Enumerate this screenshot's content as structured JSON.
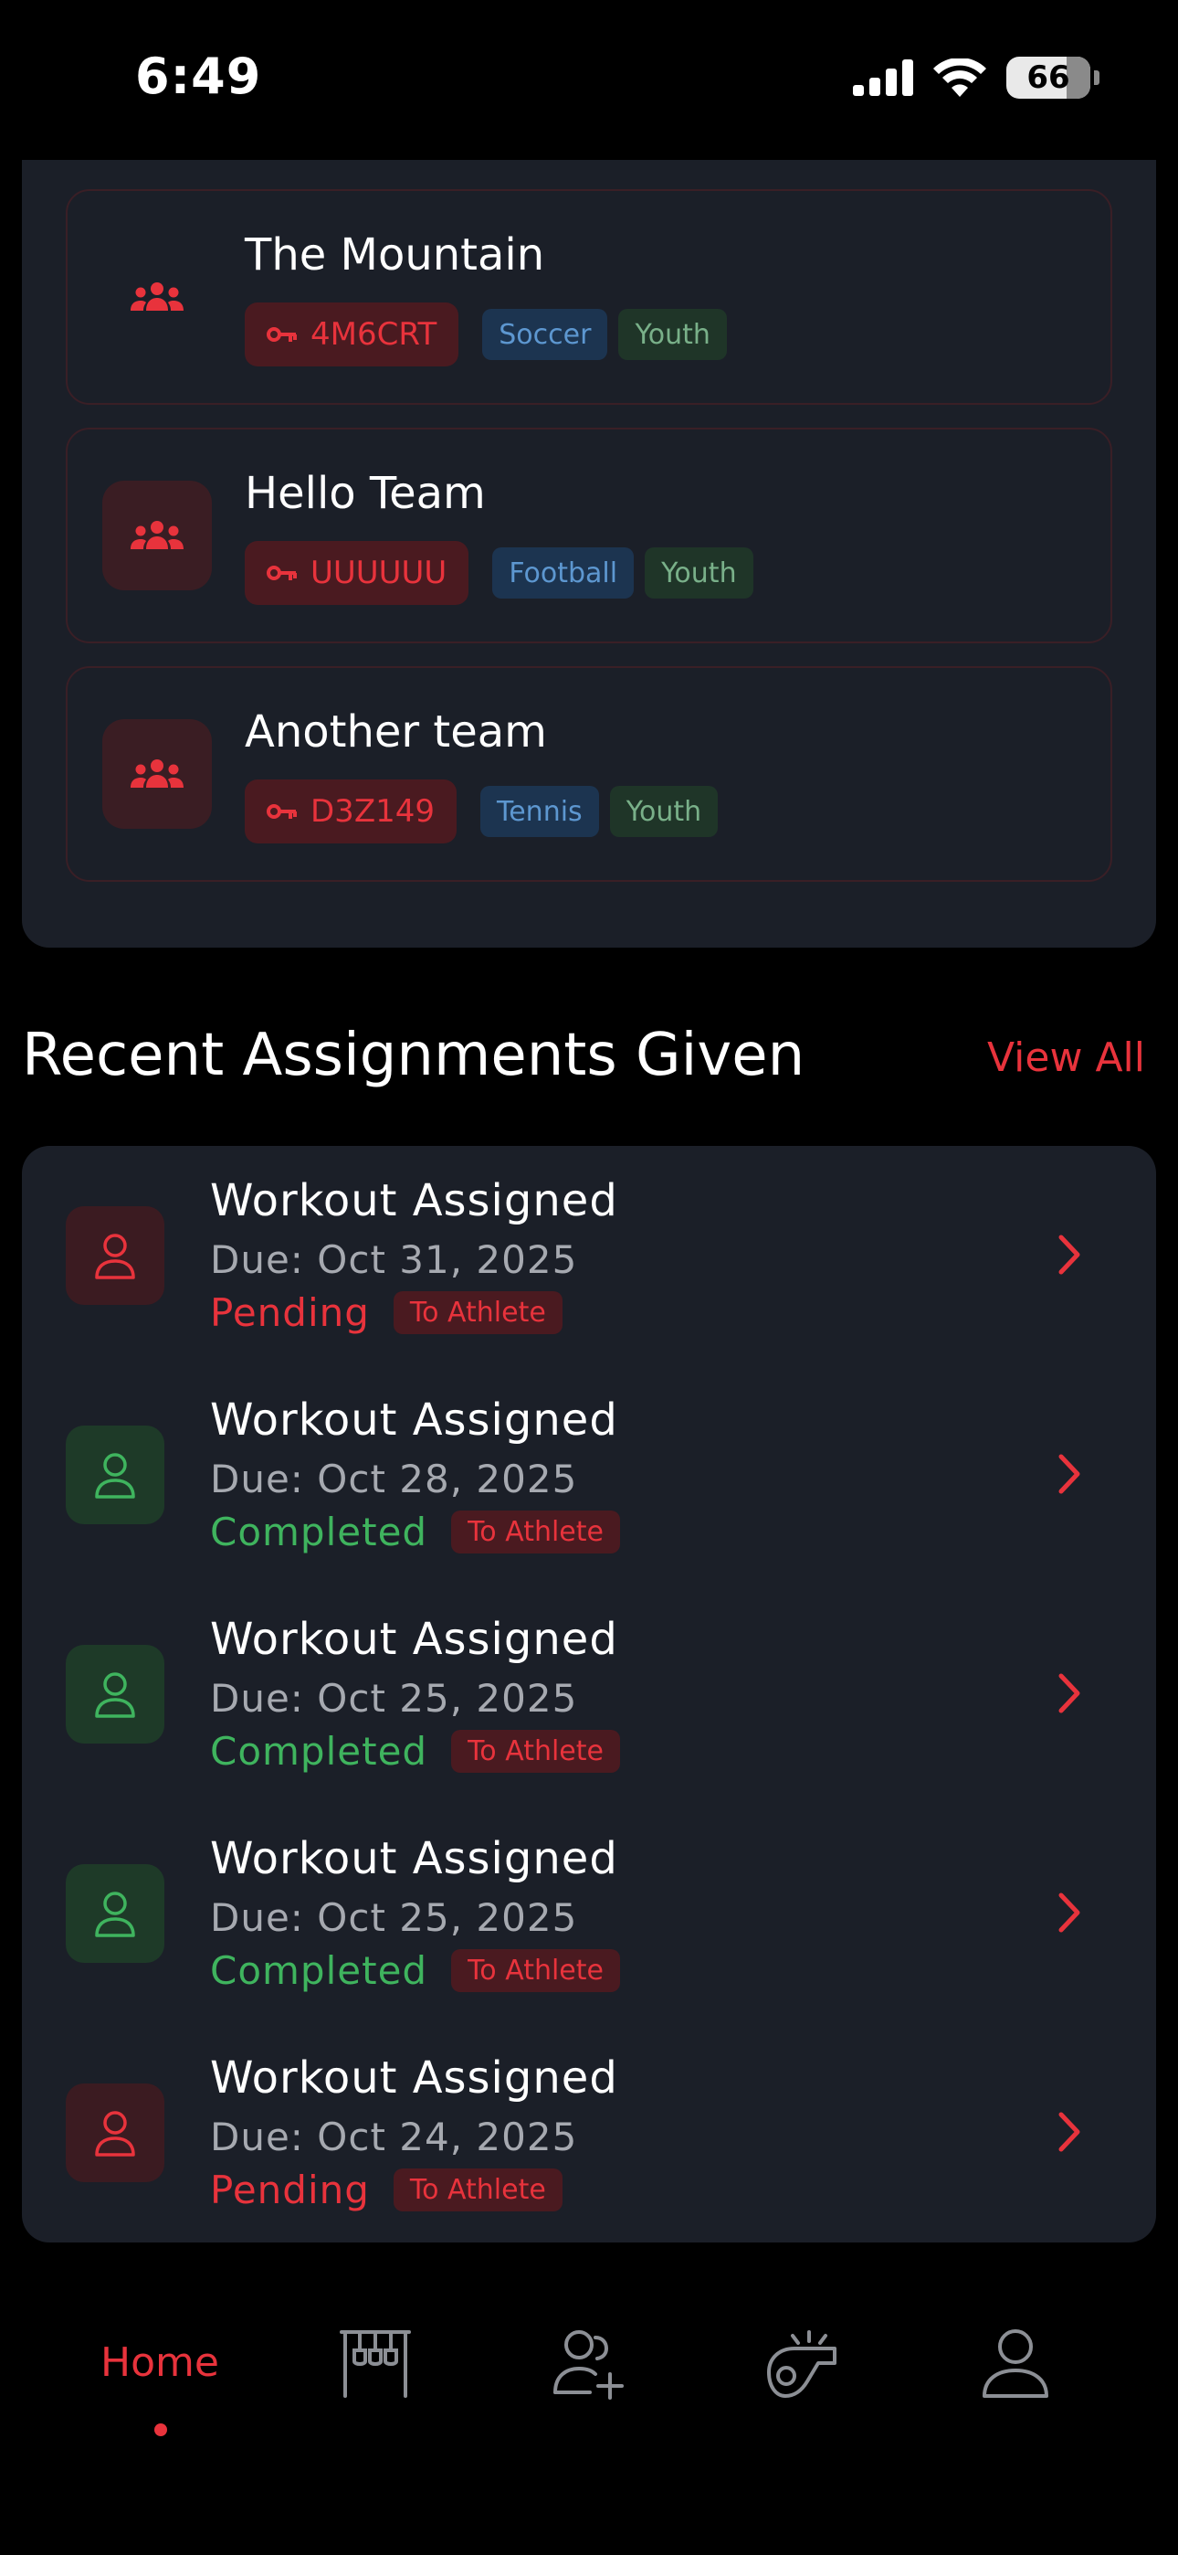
{
  "status_bar": {
    "time": "6:49",
    "battery": "66",
    "icons": [
      "cellular-signal-icon",
      "wifi-icon",
      "battery-icon"
    ]
  },
  "teams": [
    {
      "name": "The Mountain",
      "code": "4M6CRT",
      "sport": "Soccer",
      "level": "Youth"
    },
    {
      "name": "Hello Team",
      "code": "UUUUUU",
      "sport": "Football",
      "level": "Youth"
    },
    {
      "name": "Another team",
      "code": "D3Z149",
      "sport": "Tennis",
      "level": "Youth"
    }
  ],
  "recent": {
    "title": "Recent Assignments Given",
    "view_all": "View All",
    "items": [
      {
        "title": "Workout Assigned",
        "due": "Due: Oct 31, 2025",
        "status": "Pending",
        "target": "To Athlete"
      },
      {
        "title": "Workout Assigned",
        "due": "Due: Oct 28, 2025",
        "status": "Completed",
        "target": "To Athlete"
      },
      {
        "title": "Workout Assigned",
        "due": "Due: Oct 25, 2025",
        "status": "Completed",
        "target": "To Athlete"
      },
      {
        "title": "Workout Assigned",
        "due": "Due: Oct 25, 2025",
        "status": "Completed",
        "target": "To Athlete"
      },
      {
        "title": "Workout Assigned",
        "due": "Due: Oct 24, 2025",
        "status": "Pending",
        "target": "To Athlete"
      }
    ]
  },
  "nav": {
    "home_label": "Home",
    "icons": [
      "home-tab",
      "gym-rack-icon",
      "add-user-icon",
      "whistle-icon",
      "profile-icon"
    ]
  },
  "colors": {
    "accent": "#e8333c",
    "completed": "#3fb45e",
    "card": "#1b1f28",
    "background": "#000000"
  }
}
